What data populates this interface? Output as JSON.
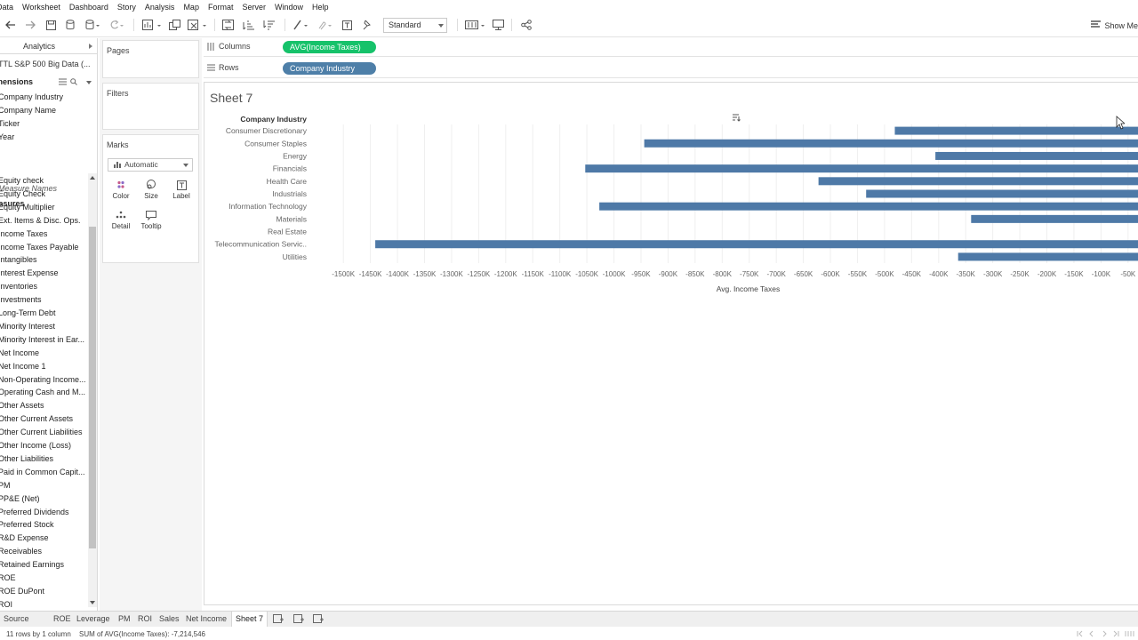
{
  "menu": [
    "Data",
    "Worksheet",
    "Dashboard",
    "Story",
    "Analysis",
    "Map",
    "Format",
    "Server",
    "Window",
    "Help"
  ],
  "toolbar": {
    "fit_value": "Standard",
    "show_me_label": "Show Me"
  },
  "datapane": {
    "tab_label": "Analytics",
    "datasource": "TTL S&P 500 Big Data (...",
    "dimensions_header": "Dimensions",
    "dimensions": [
      "Company Industry",
      "Company Name",
      "Ticker",
      "Year"
    ],
    "measure_names": "Measure Names",
    "measures_header": "Measures",
    "measures": [
      "Equity check",
      "Equity Check",
      "Equity Multiplier",
      "Ext. Items & Disc. Ops.",
      "Income Taxes",
      "Income Taxes Payable",
      "Intangibles",
      "Interest Expense",
      "Inventories",
      "Investments",
      "Long-Term Debt",
      "Minority Interest",
      "Minority Interest in Ear...",
      "Net Income",
      "Net Income 1",
      "Non-Operating Income...",
      "Operating Cash and M...",
      "Other Assets",
      "Other Current Assets",
      "Other Current Liabilities",
      "Other Income (Loss)",
      "Other Liabilities",
      "Paid in Common Capit...",
      "PM",
      "PP&E (Net)",
      "Preferred Dividends",
      "Preferred Stock",
      "R&D Expense",
      "Receivables",
      "Retained Earnings",
      "ROE",
      "ROE DuPont",
      "ROI"
    ]
  },
  "cards": {
    "pages_title": "Pages",
    "filters_title": "Filters",
    "marks_title": "Marks",
    "marks_type": "Automatic",
    "buttons": {
      "color": "Color",
      "size": "Size",
      "label": "Label",
      "detail": "Detail",
      "tooltip": "Tooltip"
    }
  },
  "shelves": {
    "columns_label": "Columns",
    "columns_pill": "AVG(Income Taxes)",
    "rows_label": "Rows",
    "rows_pill": "Company Industry"
  },
  "colors": {
    "measure_pill": "#16c26a",
    "dimension_pill": "#4e7fa8",
    "bar": "#4e79a7"
  },
  "sheet": {
    "title": "Sheet 7"
  },
  "chart_data": {
    "type": "bar",
    "orientation": "horizontal",
    "ylabel": "Company Industry",
    "xlabel": "Avg. Income Taxes",
    "xlim": [
      -1520,
      -30
    ],
    "x_unit": "K",
    "xticks": [
      -1500,
      -1450,
      -1400,
      -1350,
      -1300,
      -1250,
      -1200,
      -1150,
      -1100,
      -1050,
      -1000,
      -950,
      -900,
      -850,
      -800,
      -750,
      -700,
      -650,
      -600,
      -550,
      -500,
      -450,
      -400,
      -350,
      -300,
      -250,
      -200,
      -150,
      -100,
      -50
    ],
    "xtick_labels": [
      "-1500K",
      "-1450K",
      "-1400K",
      "-1350K",
      "-1300K",
      "-1250K",
      "-1200K",
      "-1150K",
      "-1100K",
      "-1050K",
      "-1000K",
      "-950K",
      "-900K",
      "-850K",
      "-800K",
      "-750K",
      "-700K",
      "-650K",
      "-600K",
      "-550K",
      "-500K",
      "-450K",
      "-400K",
      "-350K",
      "-300K",
      "-250K",
      "-200K",
      "-150K",
      "-100K",
      "-50K"
    ],
    "categories": [
      "Consumer Discretionary",
      "Consumer Staples",
      "Energy",
      "Financials",
      "Health Care",
      "Industrials",
      "Information Technology",
      "Materials",
      "Real Estate",
      "Telecommunication Servic..",
      "Utilities"
    ],
    "values": [
      -481,
      -944,
      -406,
      -1053,
      -622,
      -534,
      -1027,
      -340,
      null,
      -1441,
      -364
    ],
    "grid": true
  },
  "tabs": {
    "items": [
      "Source",
      "ROE",
      "Leverage",
      "PM",
      "ROI",
      "Sales",
      "Net Income",
      "Sheet 7"
    ],
    "active": "Sheet 7"
  },
  "status": {
    "rows_cols": "11 rows by 1 column",
    "sum": "SUM of AVG(Income Taxes): -7,214,546"
  }
}
